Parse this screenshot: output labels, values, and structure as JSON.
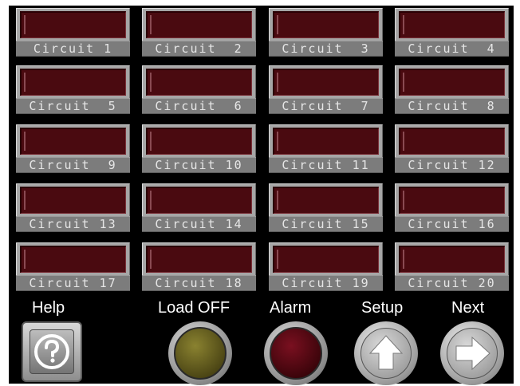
{
  "circuits": [
    {
      "label": "Circuit 1"
    },
    {
      "label": "Circuit  2"
    },
    {
      "label": "Circuit  3"
    },
    {
      "label": "Circuit  4"
    },
    {
      "label": "Circuit  5"
    },
    {
      "label": "Circuit  6"
    },
    {
      "label": "Circuit  7"
    },
    {
      "label": "Circuit  8"
    },
    {
      "label": "Circuit  9"
    },
    {
      "label": "Circuit 10"
    },
    {
      "label": "Circuit 11"
    },
    {
      "label": "Circuit 12"
    },
    {
      "label": "Circuit 13"
    },
    {
      "label": "Circuit 14"
    },
    {
      "label": "Circuit 15"
    },
    {
      "label": "Circuit 16"
    },
    {
      "label": "Circuit 17"
    },
    {
      "label": "Circuit 18"
    },
    {
      "label": "Circuit 19"
    },
    {
      "label": "Circuit 20"
    }
  ],
  "controls": {
    "help_label": "Help",
    "load_off_label": "Load OFF",
    "alarm_label": "Alarm",
    "setup_label": "Setup",
    "next_label": "Next"
  },
  "icons": {
    "help": "question-mark-icon",
    "setup": "arrow-up-icon",
    "next": "arrow-right-icon"
  },
  "colors": {
    "background": "#000000",
    "circuit_display": "#4a0a10",
    "label_bar": "#7c7c7c",
    "load_off_lamp": "#6b6320",
    "alarm_lamp": "#5a0a14"
  }
}
